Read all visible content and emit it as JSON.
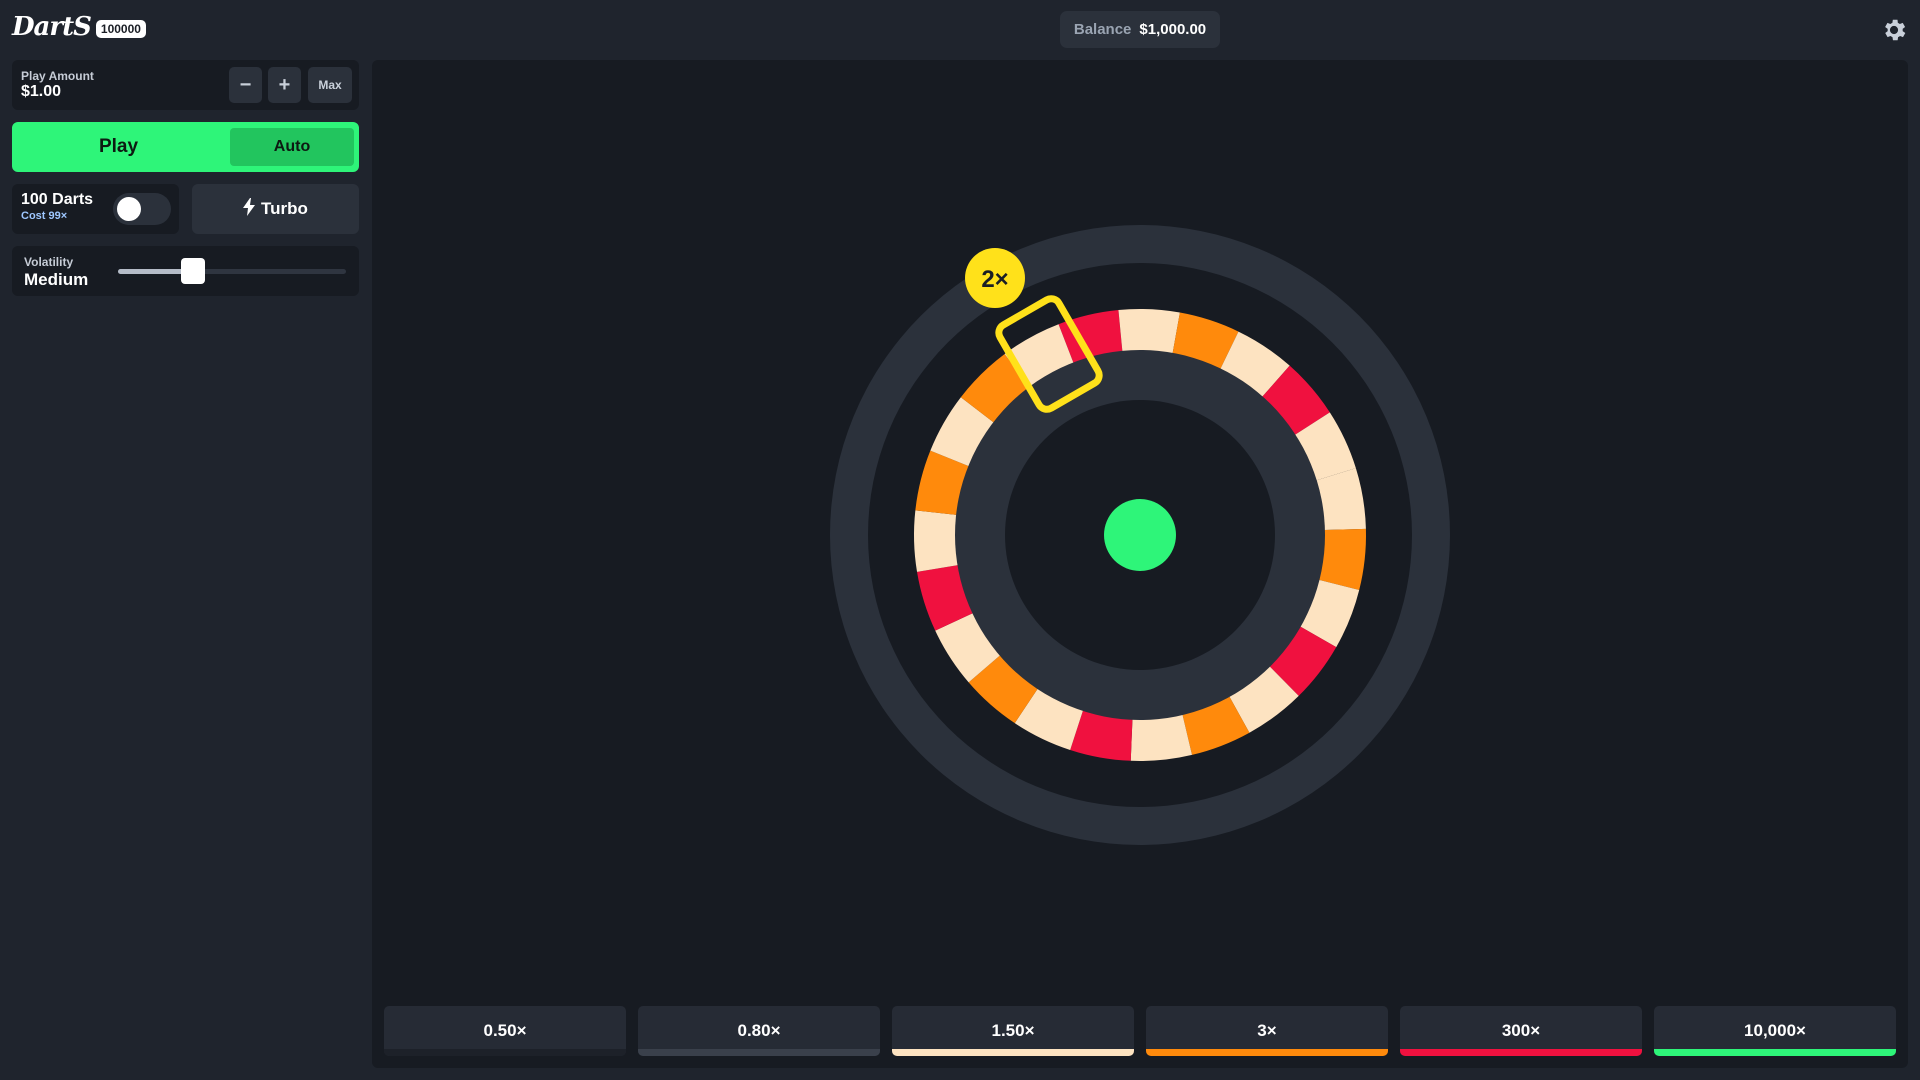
{
  "header": {
    "logo_text": "DartS",
    "logo_badge": "100000",
    "balance_label": "Balance",
    "balance_value": "$1,000.00",
    "settings_icon": "gear-icon"
  },
  "controls": {
    "play_amount_label": "Play Amount",
    "play_amount_value": "$1.00",
    "minus_label": "−",
    "plus_label": "+",
    "max_label": "Max",
    "play_label": "Play",
    "auto_label": "Auto",
    "darts_title": "100 Darts",
    "darts_cost": "Cost 99×",
    "darts_toggle_on": false,
    "turbo_label": "Turbo",
    "volatility_label": "Volatility",
    "volatility_value": "Medium",
    "volatility_level": 0.33
  },
  "board": {
    "hit_multiplier": "2×",
    "segment_colors": {
      "red": "#f0113f",
      "cream": "#fde3c1",
      "orange": "#ff8a0c",
      "center": "#2ef579",
      "ring": "#2b313b",
      "marker": "#ffe11a"
    },
    "segments": [
      "red",
      "cream",
      "orange",
      "cream",
      "red",
      "cream",
      "cream",
      "orange",
      "cream",
      "red",
      "cream",
      "orange",
      "cream",
      "red",
      "cream",
      "orange",
      "cream",
      "red",
      "cream",
      "orange",
      "cream",
      "orange",
      "cream"
    ]
  },
  "multipliers": [
    {
      "label": "0.50×",
      "color": "#1d2129"
    },
    {
      "label": "0.80×",
      "color": "#3a404b"
    },
    {
      "label": "1.50×",
      "color": "#fde3c1"
    },
    {
      "label": "3×",
      "color": "#ff8a0c"
    },
    {
      "label": "300×",
      "color": "#f0113f"
    },
    {
      "label": "10,000×",
      "color": "#2ef579"
    }
  ]
}
